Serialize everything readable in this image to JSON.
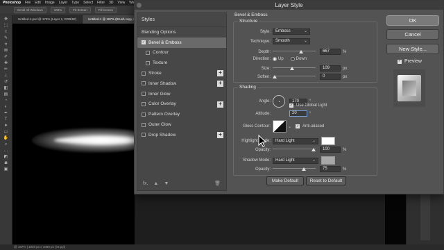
{
  "app": {
    "name": "Photoshop",
    "menus": [
      "File",
      "Edit",
      "Image",
      "Layer",
      "Type",
      "Select",
      "Filter",
      "3D",
      "View",
      "Window"
    ]
  },
  "options_bar": {
    "chips": [
      "Scroll All Windows",
      "100%",
      "Fit Screen",
      "Fill Screen"
    ]
  },
  "doc_tabs": [
    {
      "label": "Untitled-1.psd @ 173% (Layer 1, RGB/8#)"
    },
    {
      "label": "Untitled-1 @ 187% (Brush copy, RGB/8#)"
    }
  ],
  "status": {
    "text": "@ 187% | 1920 px x 1080 px (72 ppi)"
  },
  "dialog": {
    "title": "Layer Style",
    "styles_header": "Styles",
    "styles": [
      {
        "label": "Blending Options",
        "checkbox": false,
        "checked": false,
        "selected": false,
        "sub": false,
        "plus": false
      },
      {
        "label": "Bevel & Emboss",
        "checkbox": true,
        "checked": true,
        "selected": true,
        "sub": false,
        "plus": false
      },
      {
        "label": "Contour",
        "checkbox": true,
        "checked": false,
        "selected": false,
        "sub": true,
        "plus": false
      },
      {
        "label": "Texture",
        "checkbox": true,
        "checked": false,
        "selected": false,
        "sub": true,
        "plus": false
      },
      {
        "label": "Stroke",
        "checkbox": true,
        "checked": false,
        "selected": false,
        "sub": false,
        "plus": true
      },
      {
        "label": "Inner Shadow",
        "checkbox": true,
        "checked": false,
        "selected": false,
        "sub": false,
        "plus": true
      },
      {
        "label": "Inner Glow",
        "checkbox": true,
        "checked": false,
        "selected": false,
        "sub": false,
        "plus": false
      },
      {
        "label": "Color Overlay",
        "checkbox": true,
        "checked": false,
        "selected": false,
        "sub": false,
        "plus": true
      },
      {
        "label": "Pattern Overlay",
        "checkbox": true,
        "checked": false,
        "selected": false,
        "sub": false,
        "plus": false
      },
      {
        "label": "Outer Glow",
        "checkbox": true,
        "checked": false,
        "selected": false,
        "sub": false,
        "plus": false
      },
      {
        "label": "Drop Shadow",
        "checkbox": true,
        "checked": false,
        "selected": false,
        "sub": false,
        "plus": true
      }
    ],
    "footer": {
      "fx": "fx.",
      "up": "▲",
      "down": "▼",
      "trash": "🗑"
    },
    "bevel": {
      "title": "Bevel & Emboss",
      "structure_label": "Structure",
      "style_label": "Style:",
      "style_value": "Emboss",
      "technique_label": "Technique:",
      "technique_value": "Smooth",
      "depth_label": "Depth:",
      "depth_value": "667",
      "depth_unit": "%",
      "depth_fraction": 0.67,
      "direction_label": "Direction:",
      "direction_up": "Up",
      "direction_down": "Down",
      "size_label": "Size:",
      "size_value": "109",
      "size_unit": "px",
      "size_fraction": 0.45,
      "soften_label": "Soften:",
      "soften_value": "0",
      "soften_unit": "px",
      "soften_fraction": 0.0
    },
    "shading": {
      "label": "Shading",
      "angle_label": "Angle:",
      "angle_value": "170",
      "angle_unit": "°",
      "global_light_label": "Use Global Light",
      "altitude_label": "Altitude:",
      "altitude_value": "20",
      "altitude_unit": "°",
      "gloss_label": "Gloss Contour:",
      "anti_alias_label": "Anti-aliased",
      "highlight_mode_label": "Highlight Mode:",
      "highlight_mode_value": "Hard Light",
      "highlight_color": "#ffffff",
      "highlight_opacity_label": "Opacity:",
      "highlight_opacity_value": "100",
      "highlight_opacity_unit": "%",
      "highlight_opacity_fraction": 1.0,
      "shadow_mode_label": "Shadow Mode:",
      "shadow_mode_value": "Hard Light",
      "shadow_color": "#a8a8a8",
      "shadow_opacity_label": "Opacity:",
      "shadow_opacity_value": "75",
      "shadow_opacity_unit": "%",
      "shadow_opacity_fraction": 0.75
    },
    "buttons": {
      "make_default": "Make Default",
      "reset_default": "Reset to Default",
      "ok": "OK",
      "cancel": "Cancel",
      "new_style": "New Style...",
      "preview": "Preview"
    }
  }
}
